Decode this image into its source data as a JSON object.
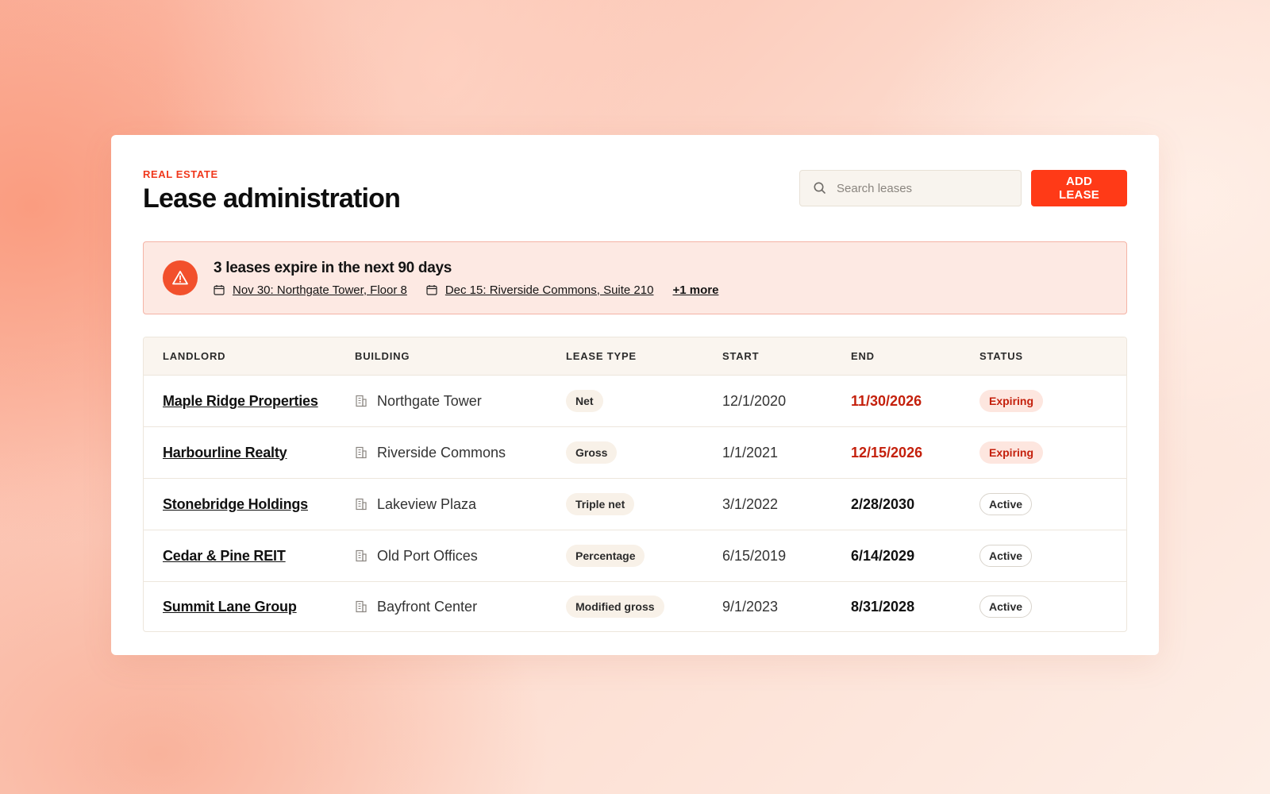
{
  "header": {
    "eyebrow": "REAL ESTATE",
    "title": "Lease administration",
    "search_placeholder": "Search leases",
    "add_label": "ADD LEASE"
  },
  "alert": {
    "title": "3 leases expire in the next 90 days",
    "links": [
      "Nov 30: Northgate Tower, Floor 8",
      "Dec 15: Riverside Commons, Suite 210"
    ],
    "more": "+1 more"
  },
  "table": {
    "columns": [
      "LANDLORD",
      "BUILDING",
      "LEASE TYPE",
      "START",
      "END",
      "STATUS"
    ],
    "rows": [
      {
        "landlord": "Maple Ridge Properties",
        "building": "Northgate Tower",
        "type": "Net",
        "start": "12/1/2020",
        "end": "11/30/2026",
        "status": "Expiring"
      },
      {
        "landlord": "Harbourline Realty",
        "building": "Riverside Commons",
        "type": "Gross",
        "start": "1/1/2021",
        "end": "12/15/2026",
        "status": "Expiring"
      },
      {
        "landlord": "Stonebridge Holdings",
        "building": "Lakeview Plaza",
        "type": "Triple net",
        "start": "3/1/2022",
        "end": "2/28/2030",
        "status": "Active"
      },
      {
        "landlord": "Cedar & Pine REIT",
        "building": "Old Port Offices",
        "type": "Percentage",
        "start": "6/15/2019",
        "end": "6/14/2029",
        "status": "Active"
      },
      {
        "landlord": "Summit Lane Group",
        "building": "Bayfront Center",
        "type": "Modified gross",
        "start": "9/1/2023",
        "end": "8/31/2028",
        "status": "Active"
      }
    ]
  },
  "icons": {
    "search": "search-icon",
    "alert": "warning-triangle-icon",
    "calendar": "calendar-icon",
    "building": "building-icon"
  },
  "colors": {
    "accent": "#ff3a17",
    "expiring": "#c4200c",
    "alert_bg": "#fde9e3"
  }
}
